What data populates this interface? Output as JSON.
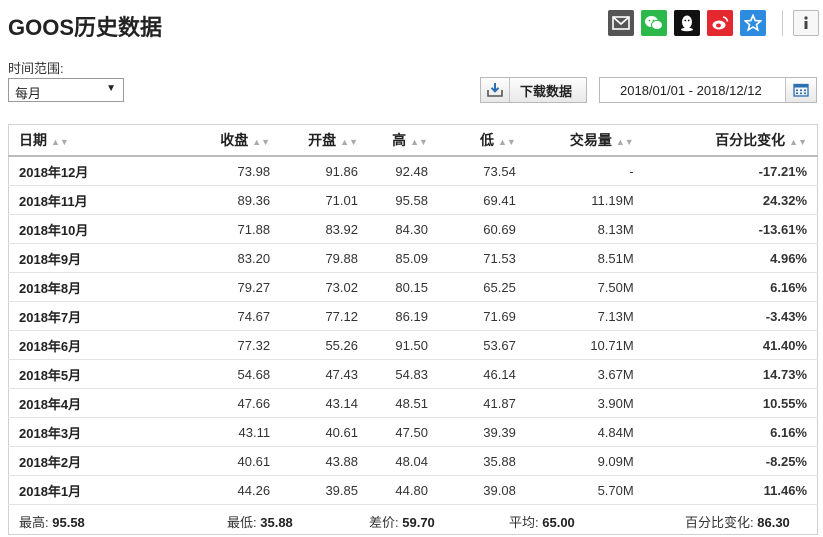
{
  "page": {
    "title": "GOOS历史数据"
  },
  "share": {
    "icons": [
      "mail-icon",
      "wechat-icon",
      "qq-icon",
      "weibo-icon",
      "favorite-icon"
    ],
    "info_icon": "info-icon"
  },
  "controls": {
    "range_label": "时间范围:",
    "period_value": "每月",
    "download_label": "下载数据",
    "date_range": "2018/01/01 - 2018/12/12"
  },
  "colors": {
    "up": "#d0021b",
    "down": "#1e9a3c"
  },
  "table": {
    "columns": [
      "日期",
      "收盘",
      "开盘",
      "高",
      "低",
      "交易量",
      "百分比变化"
    ],
    "rows": [
      {
        "date": "2018年12月",
        "close": "73.98",
        "open": "91.86",
        "high": "92.48",
        "low": "73.54",
        "volume": "-",
        "change": "-17.21%",
        "dir": "down"
      },
      {
        "date": "2018年11月",
        "close": "89.36",
        "open": "71.01",
        "high": "95.58",
        "low": "69.41",
        "volume": "11.19M",
        "change": "24.32%",
        "dir": "up"
      },
      {
        "date": "2018年10月",
        "close": "71.88",
        "open": "83.92",
        "high": "84.30",
        "low": "60.69",
        "volume": "8.13M",
        "change": "-13.61%",
        "dir": "down"
      },
      {
        "date": "2018年9月",
        "close": "83.20",
        "open": "79.88",
        "high": "85.09",
        "low": "71.53",
        "volume": "8.51M",
        "change": "4.96%",
        "dir": "up"
      },
      {
        "date": "2018年8月",
        "close": "79.27",
        "open": "73.02",
        "high": "80.15",
        "low": "65.25",
        "volume": "7.50M",
        "change": "6.16%",
        "dir": "up"
      },
      {
        "date": "2018年7月",
        "close": "74.67",
        "open": "77.12",
        "high": "86.19",
        "low": "71.69",
        "volume": "7.13M",
        "change": "-3.43%",
        "dir": "down"
      },
      {
        "date": "2018年6月",
        "close": "77.32",
        "open": "55.26",
        "high": "91.50",
        "low": "53.67",
        "volume": "10.71M",
        "change": "41.40%",
        "dir": "up"
      },
      {
        "date": "2018年5月",
        "close": "54.68",
        "open": "47.43",
        "high": "54.83",
        "low": "46.14",
        "volume": "3.67M",
        "change": "14.73%",
        "dir": "up"
      },
      {
        "date": "2018年4月",
        "close": "47.66",
        "open": "43.14",
        "high": "48.51",
        "low": "41.87",
        "volume": "3.90M",
        "change": "10.55%",
        "dir": "up"
      },
      {
        "date": "2018年3月",
        "close": "43.11",
        "open": "40.61",
        "high": "47.50",
        "low": "39.39",
        "volume": "4.84M",
        "change": "6.16%",
        "dir": "up"
      },
      {
        "date": "2018年2月",
        "close": "40.61",
        "open": "43.88",
        "high": "48.04",
        "low": "35.88",
        "volume": "9.09M",
        "change": "-8.25%",
        "dir": "down"
      },
      {
        "date": "2018年1月",
        "close": "44.26",
        "open": "39.85",
        "high": "44.80",
        "low": "39.08",
        "volume": "5.70M",
        "change": "11.46%",
        "dir": "up"
      }
    ]
  },
  "summary": {
    "high_label": "最高:",
    "high_value": "95.58",
    "low_label": "最低:",
    "low_value": "35.88",
    "diff_label": "差价:",
    "diff_value": "59.70",
    "avg_label": "平均:",
    "avg_value": "65.00",
    "change_label": "百分比变化:",
    "change_value": "86.30"
  }
}
